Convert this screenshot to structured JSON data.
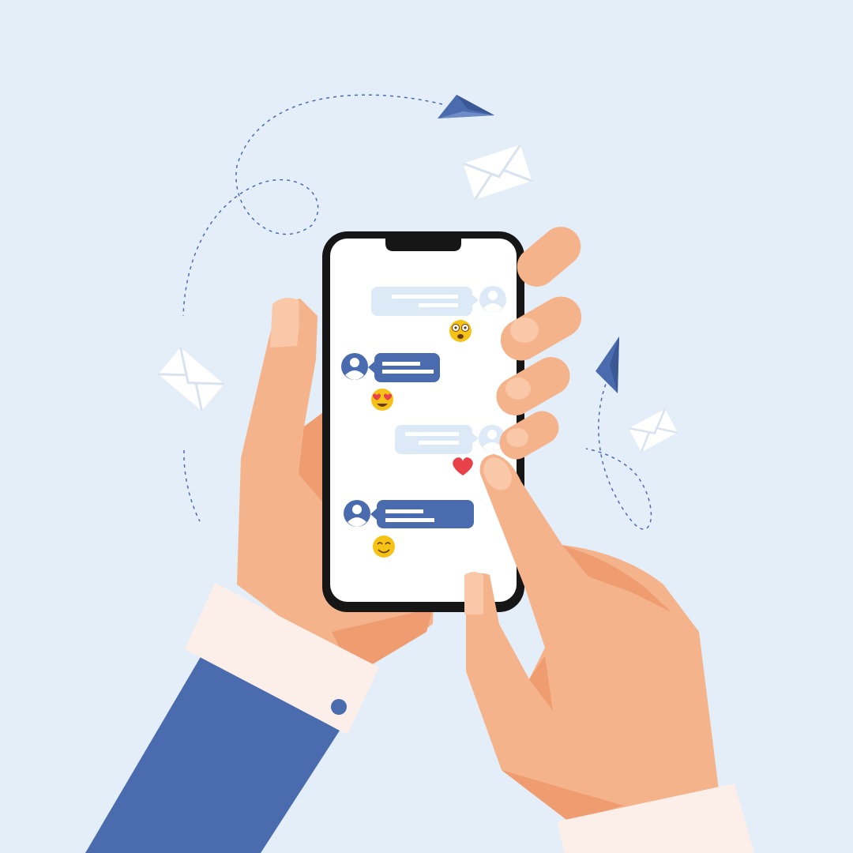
{
  "colors": {
    "background": "#E4EEF8",
    "skin": "#F5B38C",
    "skin_shadow": "#EE9C70",
    "skin_highlight": "#F8C8A8",
    "sleeve": "#4A6BAE",
    "cuff": "#FCEFEA",
    "phone_frame": "#161616",
    "screen": "#FFFFFF",
    "bubble_light": "#DCE9F6",
    "bubble_blue": "#4A6BAE",
    "emoji_yellow": "#F5C316",
    "heart": "#E8414A",
    "dashed_line": "#4A6BAE",
    "envelope": "#FFFFFF"
  },
  "icons": [
    "paper-plane-icon",
    "envelope-icon",
    "avatar-icon",
    "emoji-icon",
    "heart-icon"
  ],
  "messages": [
    {
      "side": "outgoing",
      "reaction": "dizzy-eyes-emoji"
    },
    {
      "side": "incoming",
      "reaction": "heart-eyes-emoji"
    },
    {
      "side": "outgoing",
      "reaction": "heart"
    },
    {
      "side": "incoming",
      "reaction": "smiling-emoji"
    }
  ]
}
